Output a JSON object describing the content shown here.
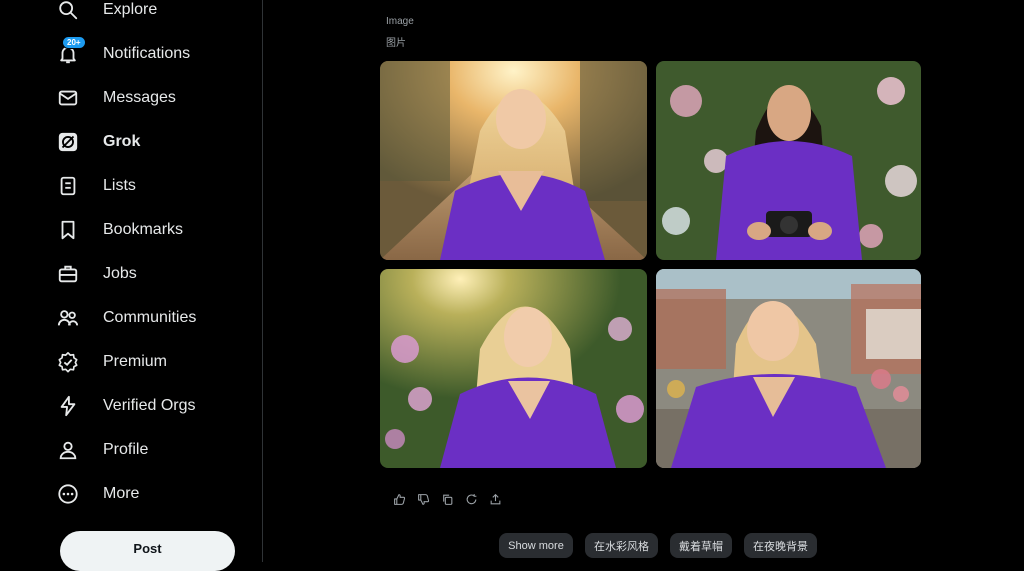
{
  "sidebar": {
    "items": [
      {
        "label": "Explore",
        "icon": "search-icon"
      },
      {
        "label": "Notifications",
        "icon": "bell-icon",
        "badge": "20+"
      },
      {
        "label": "Messages",
        "icon": "envelope-icon"
      },
      {
        "label": "Grok",
        "icon": "grok-icon",
        "active": true
      },
      {
        "label": "Lists",
        "icon": "list-icon"
      },
      {
        "label": "Bookmarks",
        "icon": "bookmark-icon"
      },
      {
        "label": "Jobs",
        "icon": "briefcase-icon"
      },
      {
        "label": "Communities",
        "icon": "people-icon"
      },
      {
        "label": "Premium",
        "icon": "verified-badge-icon"
      },
      {
        "label": "Verified Orgs",
        "icon": "lightning-icon"
      },
      {
        "label": "Profile",
        "icon": "person-icon"
      },
      {
        "label": "More",
        "icon": "more-circle-icon"
      }
    ],
    "post_label": "Post"
  },
  "main": {
    "label_en": "Image",
    "label_zh": "图片",
    "images": [
      {
        "description": "blonde woman in purple dress, sunset road"
      },
      {
        "description": "dark-haired woman in purple dress holding camera among flowers"
      },
      {
        "description": "blonde woman in purple dress among pink flowers"
      },
      {
        "description": "blonde woman in purple dress, village background"
      }
    ],
    "actions": [
      "thumbs-up-icon",
      "thumbs-down-icon",
      "copy-icon",
      "regenerate-icon",
      "share-icon"
    ],
    "suggestions": [
      "Show more",
      "在水彩风格",
      "戴着草帽",
      "在夜晚背景"
    ]
  },
  "colors": {
    "background": "#000000",
    "dress": "#6b2fc4",
    "badge": "#1d9bf0",
    "chip": "#2a2d31"
  }
}
